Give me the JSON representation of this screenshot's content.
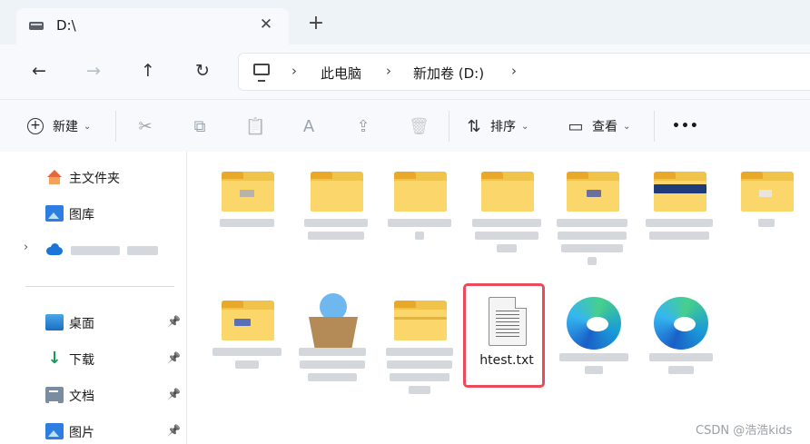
{
  "tab": {
    "title": "D:\\",
    "close_glyph": "✕",
    "new_tab_glyph": "+"
  },
  "nav": {
    "back_glyph": "←",
    "forward_glyph": "→",
    "up_glyph": "↑",
    "refresh_glyph": "↻",
    "breadcrumbs": [
      "此电脑",
      "新加卷 (D:)"
    ],
    "separator": "›"
  },
  "toolbar": {
    "new_label": "新建",
    "new_glyph": "+",
    "cut_glyph": "✂",
    "copy_glyph": "⧉",
    "paste_glyph": "📋",
    "rename_glyph": "A",
    "share_glyph": "⇪",
    "delete_glyph": "🗑",
    "sort_label": "排序",
    "sort_glyph": "⇅",
    "view_label": "查看",
    "view_glyph": "▭",
    "more_glyph": "•••",
    "caret": "⌄"
  },
  "sidebar": {
    "items": [
      {
        "label": "主文件夹",
        "icon": "home-icon",
        "pinned": false
      },
      {
        "label": "图库",
        "icon": "gallery-icon",
        "pinned": false
      },
      {
        "label": "",
        "icon": "onedrive-icon",
        "pinned": false,
        "expandable": true
      },
      {
        "label": "桌面",
        "icon": "desktop-icon",
        "pinned": true
      },
      {
        "label": "下载",
        "icon": "download-icon",
        "pinned": true
      },
      {
        "label": "文档",
        "icon": "documents-icon",
        "pinned": true
      },
      {
        "label": "图片",
        "icon": "pictures-icon",
        "pinned": true
      }
    ],
    "pin_glyph": "📌",
    "expander_glyph": "›"
  },
  "files": {
    "highlighted_file": {
      "name": "htest.txt",
      "icon": "text-file-icon"
    }
  },
  "watermark": "CSDN @浩浩kids",
  "colors": {
    "highlight": "#ea4b5c",
    "folder": "#f0c34a",
    "accent": "#1b74d8"
  }
}
